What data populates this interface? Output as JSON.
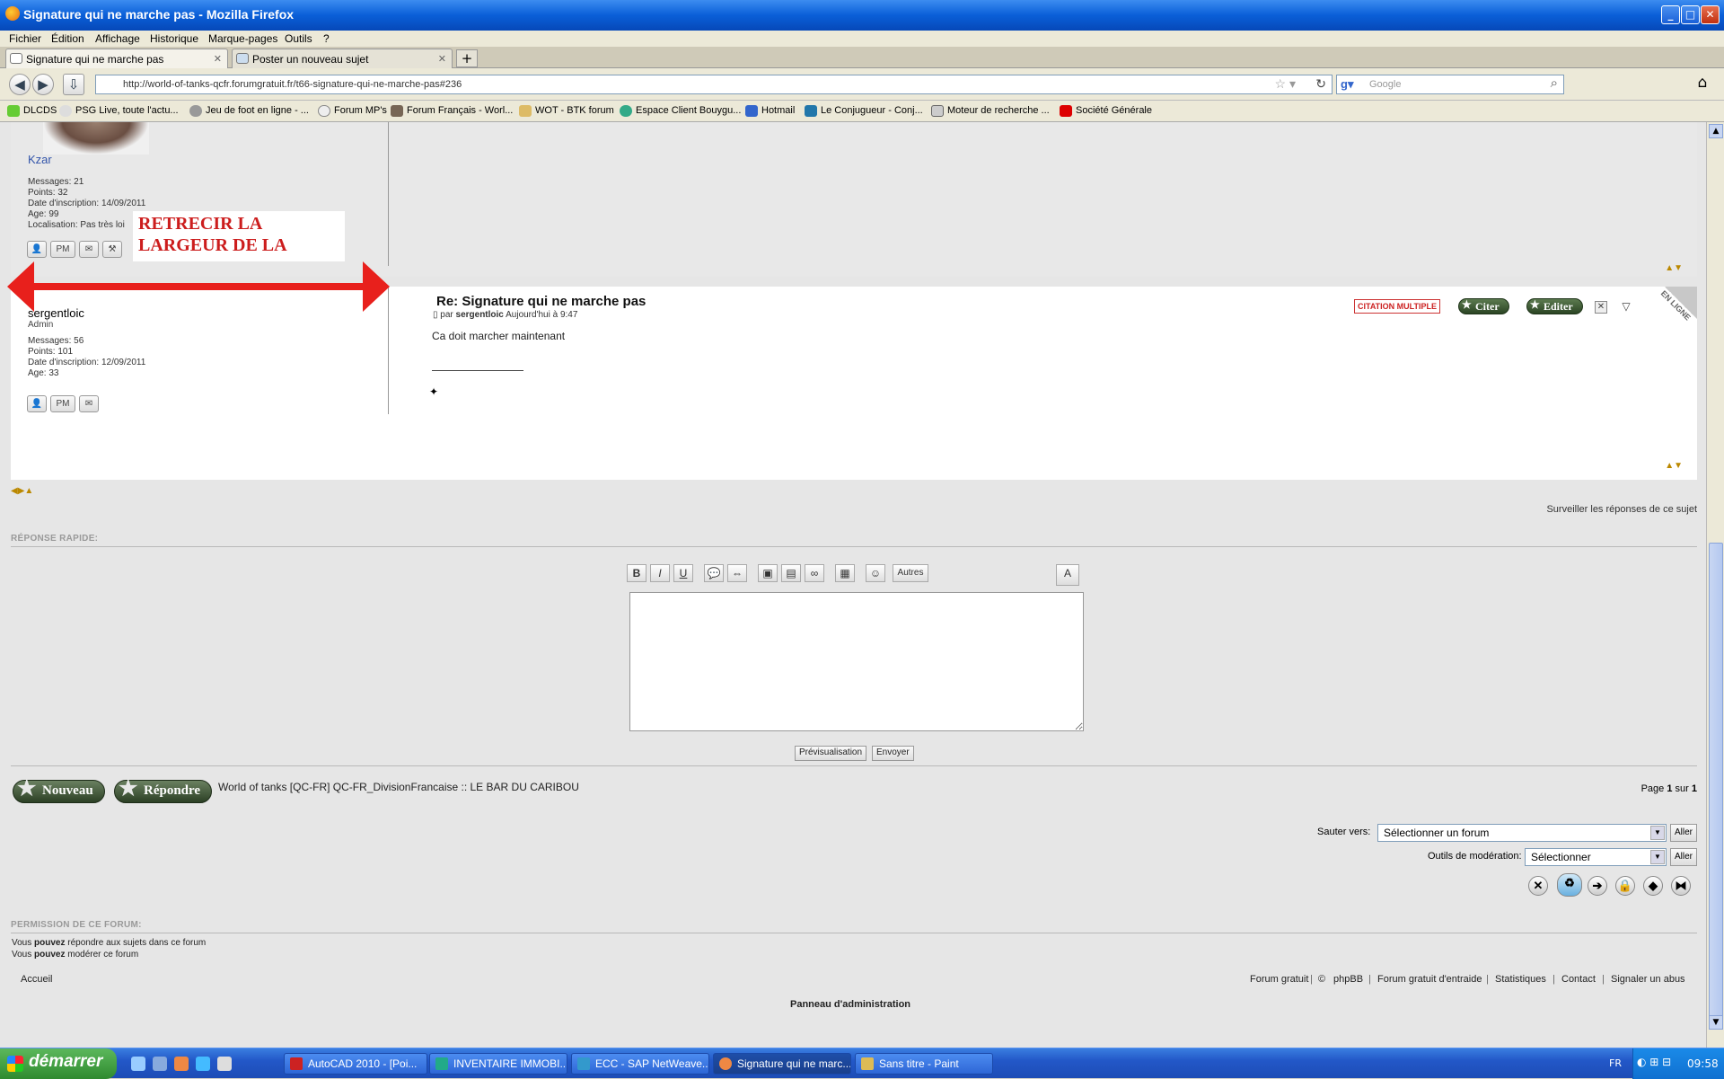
{
  "window": {
    "title": "Signature qui ne marche pas - Mozilla Firefox"
  },
  "menu": [
    "Fichier",
    "Édition",
    "Affichage",
    "Historique",
    "Marque-pages",
    "Outils",
    "?"
  ],
  "tabs": [
    {
      "label": "Signature qui ne marche pas"
    },
    {
      "label": "Poster un nouveau sujet"
    }
  ],
  "nav": {
    "url": "http://world-of-tanks-qcfr.forumgratuit.fr/t66-signature-qui-ne-marche-pas#236",
    "search_placeholder": "Google"
  },
  "bookmarks": [
    "DLCDS",
    "PSG Live, toute l'actu...",
    "Jeu de foot en ligne - ...",
    "Forum MP's",
    "Forum Français - Worl...",
    "WOT - BTK forum",
    "Espace Client Bouygu...",
    "Hotmail",
    "Le Conjugueur - Conj...",
    "Moteur de recherche ...",
    "Société Générale"
  ],
  "colors": {
    "annotation": "#cc1d1d",
    "accent_button": "#2b4524",
    "link": "#3355aa"
  },
  "post1": {
    "username": "Kzar",
    "stats": [
      "Messages: 21",
      "Points: 32",
      "Date d'inscription: 14/09/2011",
      "Age: 99",
      "Localisation: Pas très loi"
    ]
  },
  "annotation": {
    "text": "RETRECIR LA LARGEUR DE LA"
  },
  "post2": {
    "username": "sergentloic",
    "rank": "Admin",
    "stats": [
      "Messages: 56",
      "Points: 101",
      "Date d'inscription: 12/09/2011",
      "Age: 33"
    ],
    "title": "Re: Signature qui ne marche pas",
    "by_prefix": "par",
    "by_user": "sergentloic",
    "by_time": "Aujourd'hui à 9:47",
    "body": "Ca doit marcher maintenant",
    "online": "EN LIGNE",
    "btn_multi": "CITATION MULTIPLE",
    "btn_quote": "Citer",
    "btn_edit": "Editer"
  },
  "watch": "Surveiller les réponses de ce sujet",
  "quickreply": {
    "title": "RÉPONSE RAPIDE:",
    "other": "Autres",
    "preview": "Prévisualisation",
    "send": "Envoyer"
  },
  "actions": {
    "new": "Nouveau",
    "reply": "Répondre",
    "breadcrumb": "World of tanks [QC-FR] QC-FR_DivisionFrancaise :: LE BAR DU CARIBOU",
    "page_prefix": "Page",
    "page_cur": "1",
    "page_sep": "sur",
    "page_total": "1"
  },
  "jump": {
    "label": "Sauter vers:",
    "value": "Sélectionner un forum",
    "go": "Aller"
  },
  "mod": {
    "label": "Outils de modération:",
    "value": "Sélectionner",
    "go": "Aller"
  },
  "permissions": {
    "title": "PERMISSION DE CE FORUM:",
    "line1_a": "Vous",
    "line1_b": "pouvez",
    "line1_c": "répondre aux sujets dans ce forum",
    "line2_a": "Vous",
    "line2_b": "pouvez",
    "line2_c": "modérer ce forum"
  },
  "footer": {
    "home": "Accueil",
    "links": [
      "Forum gratuit",
      "©",
      "phpBB",
      "Forum gratuit d'entraide",
      "Statistiques",
      "Contact",
      "Signaler un abus"
    ],
    "admin": "Panneau d'administration"
  },
  "taskbar": {
    "start": "démarrer",
    "items": [
      "AutoCAD 2010 - [Poi...",
      "INVENTAIRE IMMOBI...",
      "ECC - SAP NetWeave...",
      "Signature qui ne marc...",
      "Sans titre - Paint"
    ],
    "lang": "FR",
    "clock": "09:58"
  }
}
